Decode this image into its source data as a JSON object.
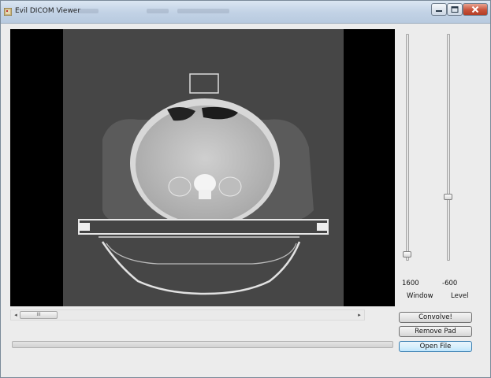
{
  "window": {
    "title": "Evil DICOM Viewer",
    "icons": {
      "app": "dicom-app-icon",
      "minimize": "minimize-icon",
      "maximize": "maximize-icon",
      "close": "close-icon"
    }
  },
  "image": {
    "description_icon": "ct-scan-image"
  },
  "sliders": {
    "window": {
      "label": "Window",
      "value": "1600",
      "level_fraction": 0.0
    },
    "level": {
      "label": "Level",
      "value": "-600",
      "level_fraction": 0.26
    }
  },
  "hscroll": {
    "thumb_grip": "III",
    "left_arrow": "◂",
    "right_arrow": "▸"
  },
  "buttons": {
    "convolve": "Convolve!",
    "remove_pad": "Remove Pad",
    "open_file": "Open File"
  },
  "progress": {
    "fraction": 0.0
  }
}
